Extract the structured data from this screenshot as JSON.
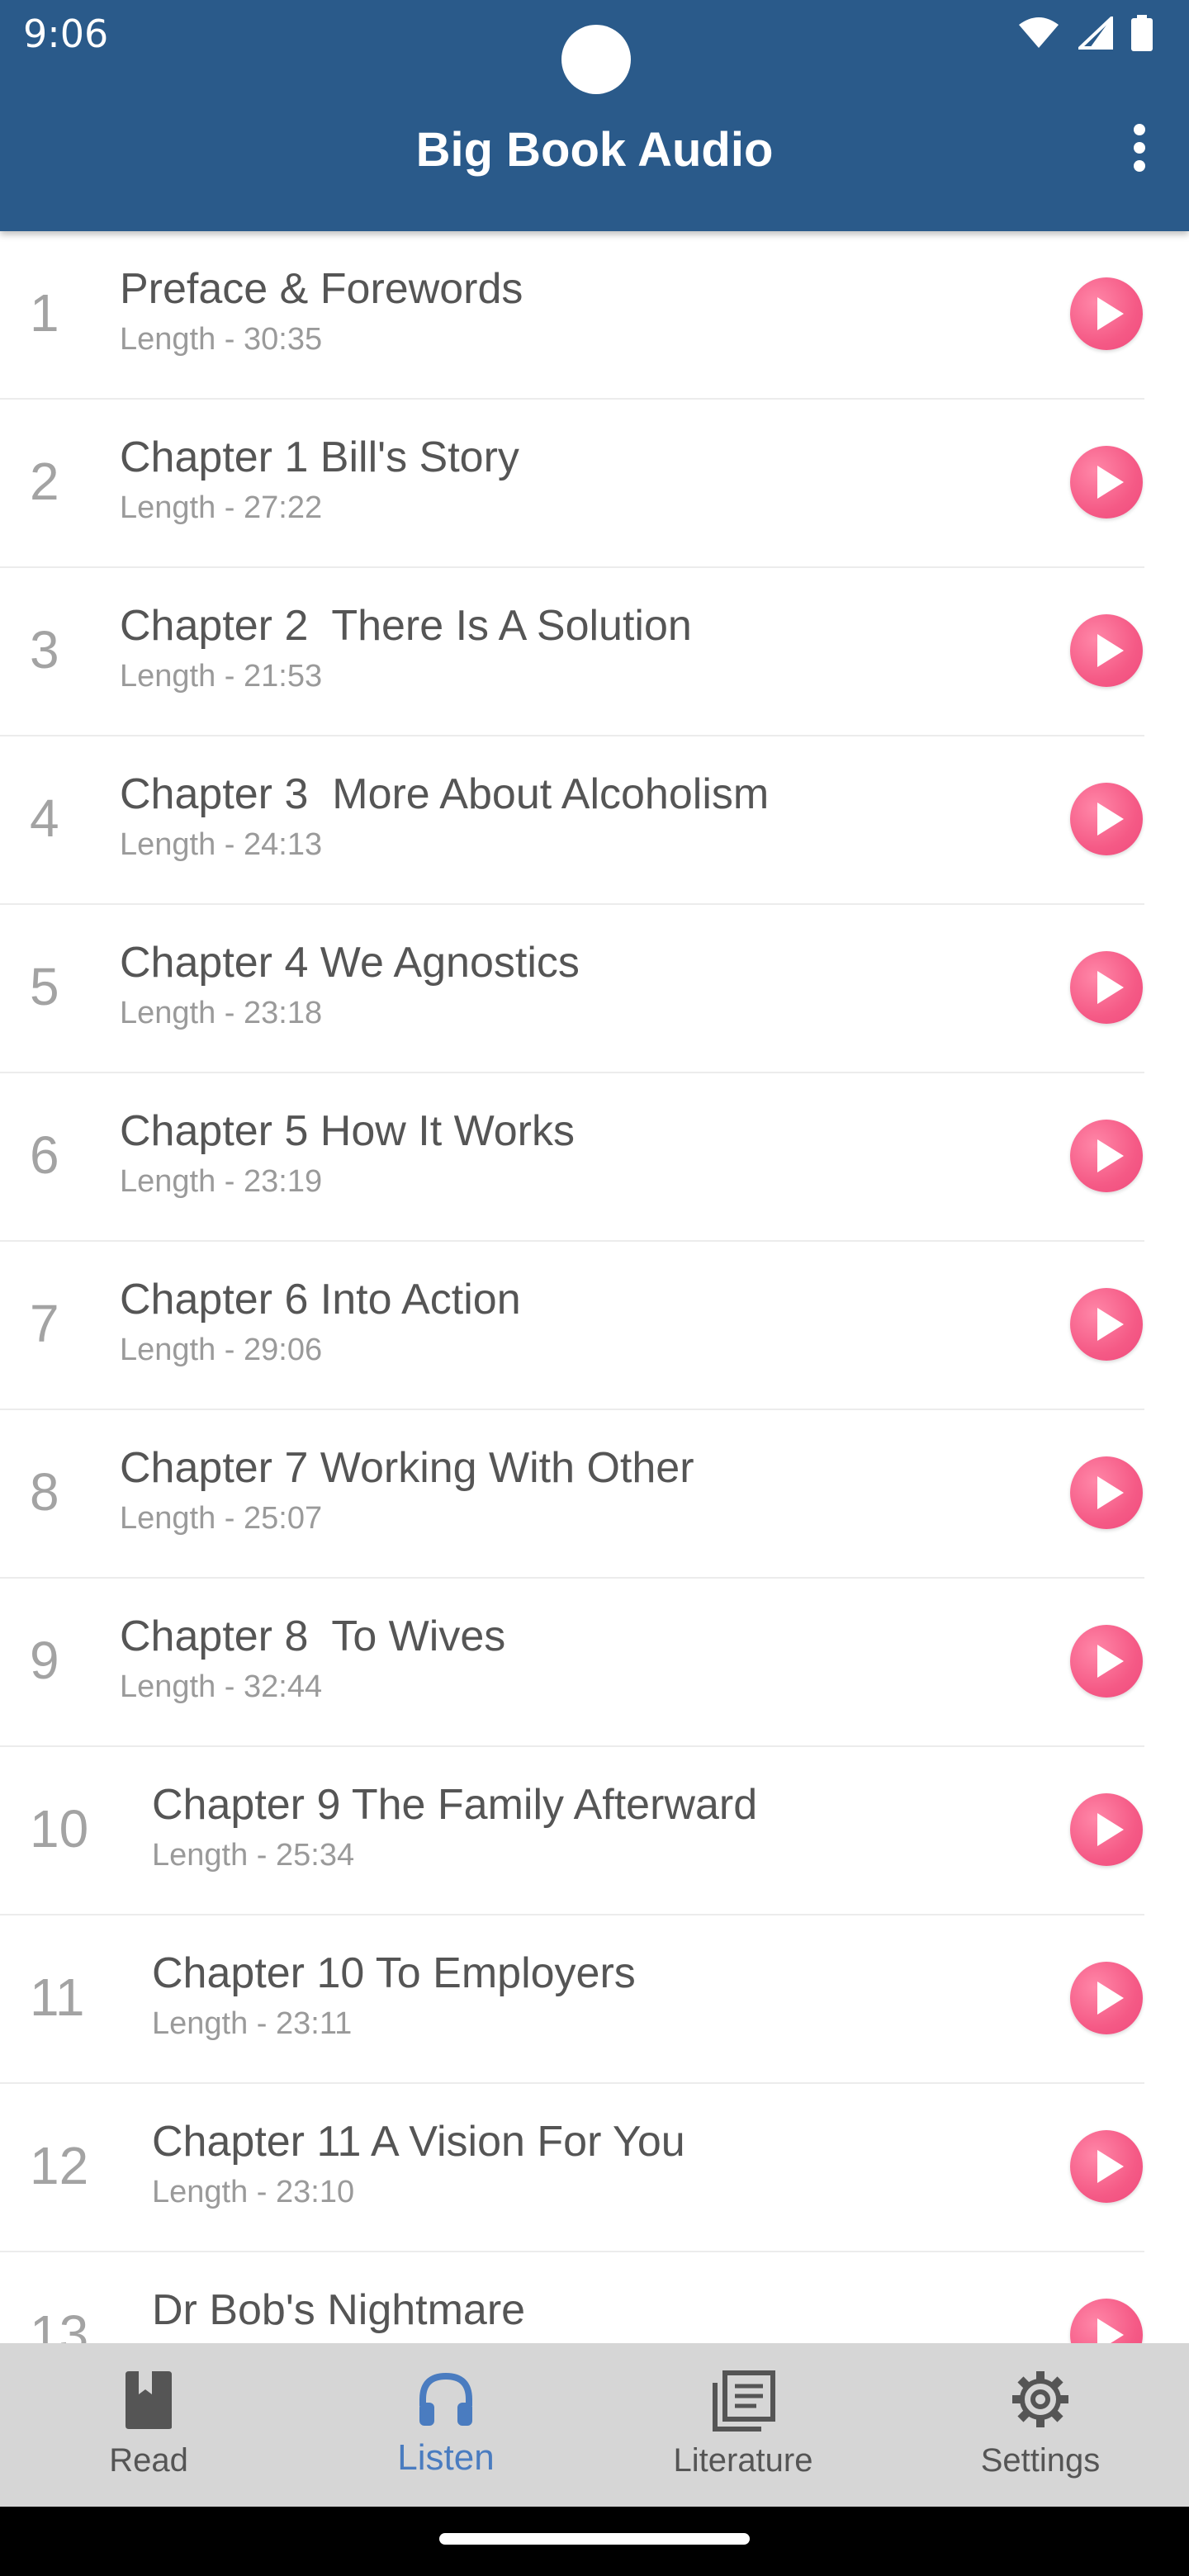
{
  "status": {
    "time": "9:06"
  },
  "app": {
    "title": "Big Book Audio"
  },
  "tracks": [
    {
      "num": "1",
      "title": "Preface & Forewords",
      "length": "Length - 30:35"
    },
    {
      "num": "2",
      "title": "Chapter 1 Bill's Story",
      "length": "Length - 27:22"
    },
    {
      "num": "3",
      "title": "Chapter 2  There Is A Solution",
      "length": "Length - 21:53"
    },
    {
      "num": "4",
      "title": "Chapter 3  More About Alcoholism",
      "length": "Length - 24:13"
    },
    {
      "num": "5",
      "title": "Chapter 4 We Agnostics",
      "length": "Length - 23:18"
    },
    {
      "num": "6",
      "title": "Chapter 5 How It Works",
      "length": "Length - 23:19"
    },
    {
      "num": "7",
      "title": "Chapter 6 Into Action",
      "length": "Length - 29:06"
    },
    {
      "num": "8",
      "title": "Chapter 7 Working With Other",
      "length": "Length - 25:07"
    },
    {
      "num": "9",
      "title": "Chapter 8  To Wives",
      "length": "Length - 32:44"
    },
    {
      "num": "10",
      "title": "Chapter 9 The Family Afterward",
      "length": "Length - 25:34"
    },
    {
      "num": "11",
      "title": "Chapter 10 To Employers",
      "length": "Length - 23:11"
    },
    {
      "num": "12",
      "title": "Chapter 11 A Vision For You",
      "length": "Length - 23:10"
    },
    {
      "num": "13",
      "title": "Dr Bob's Nightmare",
      "length": ""
    }
  ],
  "nav": {
    "read": "Read",
    "listen": "Listen",
    "literature": "Literature",
    "settings": "Settings",
    "active": "listen",
    "active_color": "#4a7cc0"
  },
  "colors": {
    "appbar": "#2a5a8a",
    "play_button": "#f55a86",
    "nav_background": "#d6d6d6"
  }
}
